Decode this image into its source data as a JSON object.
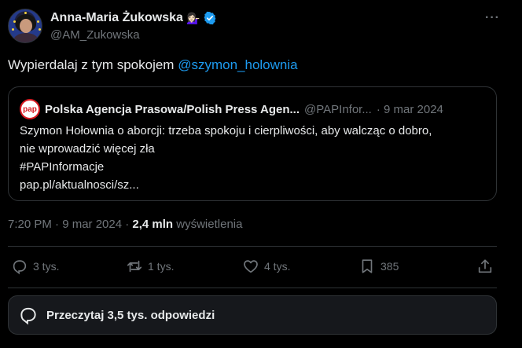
{
  "author": {
    "name": "Anna-Maria Żukowska",
    "emoji": "💁🏻‍♀️",
    "handle": "@AM_Zukowska"
  },
  "tweet": {
    "text": "Wypierdalaj z tym spokojem ",
    "mention": "@szymon_holownia"
  },
  "quote": {
    "logo_text": "pap",
    "name": "Polska Agencja Prasowa/Polish Press Agen...",
    "handle": "@PAPInfor...",
    "date": "· 9 mar 2024",
    "line1": "Szymon Hołownia o aborcji: trzeba spokoju i cierpliwości, aby walcząc o dobro,",
    "line2": "nie wprowadzić więcej zła",
    "line3": "#PAPInformacje",
    "line4": "pap.pl/aktualnosci/sz..."
  },
  "meta": {
    "time": "7:20 PM · 9 mar 2024 · ",
    "views_count": "2,4 mln",
    "views_label": " wyświetlenia"
  },
  "actions": {
    "replies": "3 tys.",
    "reposts": "1 tys.",
    "likes": "4 tys.",
    "bookmarks": "385"
  },
  "read_replies": "Przeczytaj 3,5 tys. odpowiedzi",
  "colors": {
    "background": "#000000",
    "text": "#e7e9ea",
    "muted": "#71767b",
    "accent": "#1d9bf0",
    "border": "#2f3336",
    "pap_red": "#d71920"
  }
}
